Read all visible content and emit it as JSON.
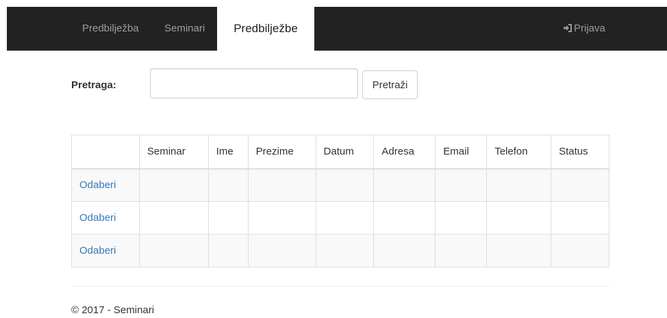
{
  "navbar": {
    "brand": "Predbilježba",
    "items": [
      {
        "label": "Seminari"
      },
      {
        "label": "Predbilježbe",
        "active": true
      }
    ],
    "login": {
      "label": "Prijava",
      "icon": "log-in-icon"
    }
  },
  "search": {
    "label": "Pretraga:",
    "value": "",
    "placeholder": "",
    "button_label": "Pretraži"
  },
  "table": {
    "columns": [
      "",
      "Seminar",
      "Ime",
      "Prezime",
      "Datum",
      "Adresa",
      "Email",
      "Telefon",
      "Status"
    ],
    "rows": [
      {
        "select_label": "Odaberi",
        "cells": [
          "",
          "",
          "",
          "",
          "",
          "",
          "",
          ""
        ]
      },
      {
        "select_label": "Odaberi",
        "cells": [
          "",
          "",
          "",
          "",
          "",
          "",
          "",
          ""
        ]
      },
      {
        "select_label": "Odaberi",
        "cells": [
          "",
          "",
          "",
          "",
          "",
          "",
          "",
          ""
        ]
      }
    ]
  },
  "footer": {
    "text": "© 2017 - Seminari"
  },
  "colors": {
    "navbar_bg": "#222222",
    "link": "#337ab7",
    "nav_text": "#9d9d9d"
  }
}
